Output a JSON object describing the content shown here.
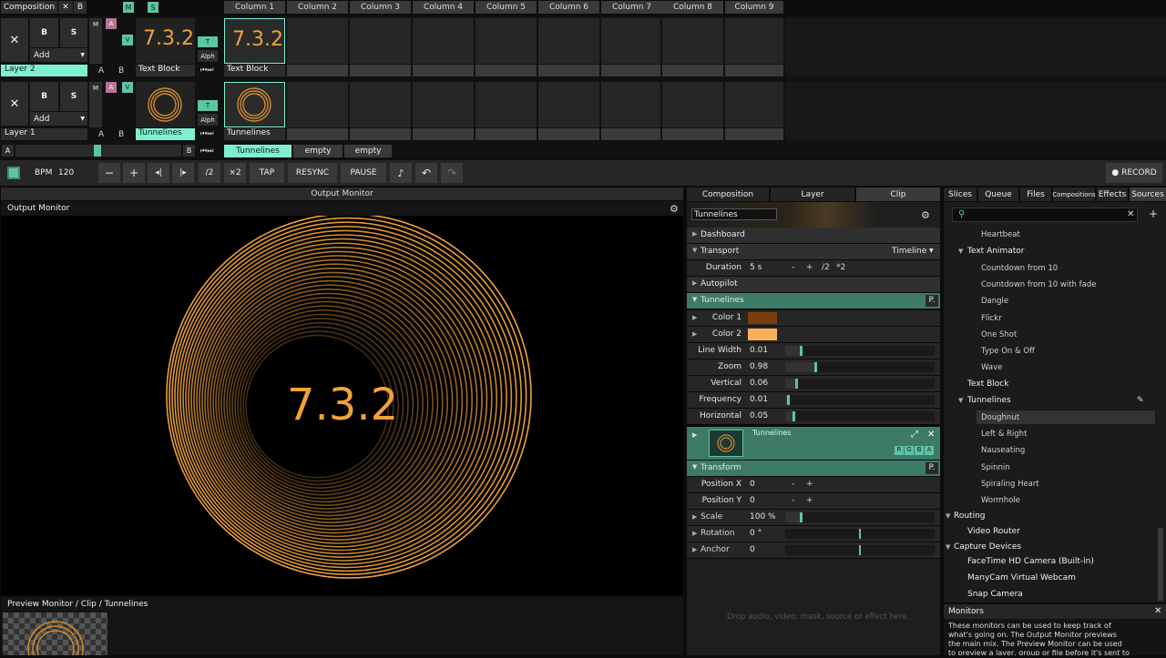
{
  "composition": {
    "label": "Composition",
    "x": "✕",
    "b": "B",
    "m": "M",
    "s": "S"
  },
  "columns": [
    "Column 1",
    "Column 2",
    "Column 3",
    "Column 4",
    "Column 5",
    "Column 6",
    "Column 7",
    "Column 8",
    "Column 9"
  ],
  "layers": [
    {
      "name": "Layer 2",
      "x": "✕",
      "b": "B",
      "s": "S",
      "add": "Add",
      "m": "M",
      "a": "A",
      "v": "V",
      "ab_a": "A",
      "ab_b": "B",
      "thumb_text": "7.3.2",
      "clip_name": "Text Block",
      "t": "T",
      "alph": "Alph",
      "clips": [
        {
          "name": "Text Block",
          "thumb": "7.3.2"
        }
      ]
    },
    {
      "name": "Layer 1",
      "x": "✕",
      "b": "B",
      "s": "S",
      "add": "Add",
      "m": "M",
      "a": "A",
      "v": "V",
      "ab_a": "A",
      "ab_b": "B",
      "clip_name": "Tunnelines",
      "t": "T",
      "alph": "Alph",
      "clips": [
        {
          "name": "Tunnelines"
        }
      ]
    }
  ],
  "deck": {
    "a": "A",
    "b": "B",
    "tabs": [
      "Tunnelines",
      "empty",
      "empty"
    ]
  },
  "transport": {
    "bpm_label": "BPM",
    "bpm": "120",
    "minus": "−",
    "plus": "+",
    "div2": "/2",
    "x2": "×2",
    "tap": "TAP",
    "resync": "RESYNC",
    "pause": "PAUSE",
    "record": "RECORD"
  },
  "output": {
    "header": "Output Monitor",
    "title": "Output Monitor",
    "text": "7.3.2",
    "accent": "#f0a23a"
  },
  "preview": {
    "title": "Preview Monitor / Clip / Tunnelines"
  },
  "tabs_mid": [
    "Composition",
    "Layer",
    "Clip"
  ],
  "clip_panel": {
    "name_value": "Tunnelines",
    "dashboard": "Dashboard",
    "transport": "Transport",
    "timeline": "Timeline",
    "duration_label": "Duration",
    "duration": "5 s",
    "dur_minus": "-",
    "dur_plus": "+",
    "dur_div": "/2",
    "dur_mul": "*2",
    "autopilot": "Autopilot",
    "tunnelines": "Tunnelines",
    "p": "P.",
    "color1": "Color 1",
    "color1_hex": "#7a3e08",
    "color2": "Color 2",
    "color2_hex": "#f6b25a",
    "params": [
      {
        "name": "Line Width",
        "value": "0.01",
        "level": 0.1
      },
      {
        "name": "Zoom",
        "value": "0.98",
        "level": 0.2
      },
      {
        "name": "Vertical",
        "value": "0.06",
        "level": 0.07
      },
      {
        "name": "Frequency",
        "value": "0.01",
        "level": 0.01
      },
      {
        "name": "Horizontal",
        "value": "0.05",
        "level": 0.05
      }
    ],
    "effect_name": "Tunnelines",
    "rgba": [
      "R",
      "G",
      "B",
      "A"
    ],
    "transform": "Transform",
    "posx_label": "Position X",
    "posx": "0",
    "posy_label": "Position Y",
    "posy": "0",
    "pm_minus": "-",
    "pm_plus": "+",
    "scale_label": "Scale",
    "scale": "100 %",
    "rotation_label": "Rotation",
    "rotation": "0 °",
    "anchor_label": "Anchor",
    "anchor": "0",
    "drop_hint": "Drop audio, video, mask, source or effect here."
  },
  "tabs_right": [
    "Slices",
    "Queue",
    "Files",
    "Compositions",
    "Effects",
    "Sources"
  ],
  "sources": {
    "heartbeat": "Heartbeat",
    "text_animator": "Text Animator",
    "ta_items": [
      "Countdown from 10",
      "Countdown from 10 with fade",
      "Dangle",
      "Flickr",
      "One Shot",
      "Type On & Off",
      "Wave"
    ],
    "text_block": "Text Block",
    "tunnelines": "Tunnelines",
    "tn_items": [
      "Doughnut",
      "Left & Right",
      "Nauseating",
      "Spinnin",
      "Spiraling Heart",
      "Wormhole"
    ],
    "routing": "Routing",
    "video_router": "Video Router",
    "capture": "Capture Devices",
    "devices": [
      "FaceTime HD Camera (Built-in)",
      "ManyCam Virtual Webcam",
      "Snap Camera"
    ]
  },
  "monitors": {
    "title": "Monitors",
    "close": "✕",
    "text": "These monitors can be used to keep track of what's going on. The Output Monitor previews the main mix. The Preview Monitor can be used to preview a layer, group or file before it's sent to the mix."
  }
}
